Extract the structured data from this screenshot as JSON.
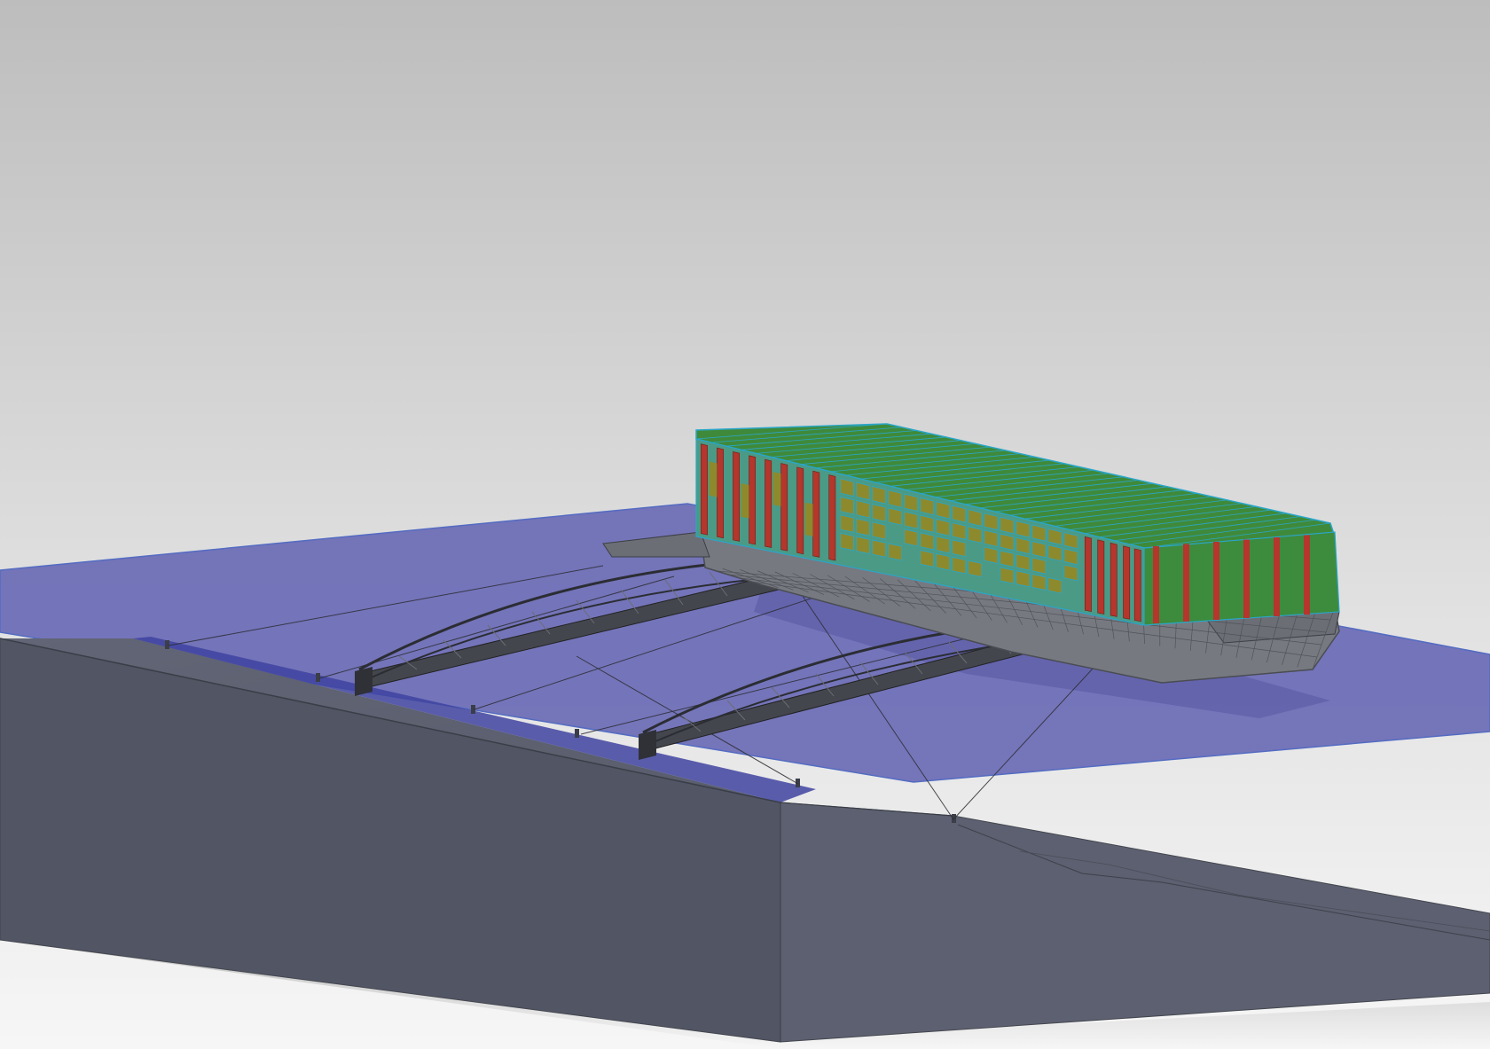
{
  "scene": {
    "model": "floating-hull-with-gangway-bridges-and-quay",
    "colors": {
      "sky_top": "#bdbdbd",
      "sky_bottom": "#f4f4f4",
      "water_plane": "#6f6fb8",
      "water_edge": "#4d66c0",
      "quay_top": "#5e6272",
      "quay_side": "#515564",
      "slope": "#666a7a",
      "hull": "#777981",
      "hull_line": "#4a4c52",
      "bridge": "#3a3c42",
      "frame_red": "#b5362c",
      "frame_green": "#3f8a3a",
      "frame_cyan": "#2aa6c8",
      "panel_olive": "#8d8a2e",
      "cable": "#2c2d33"
    }
  }
}
